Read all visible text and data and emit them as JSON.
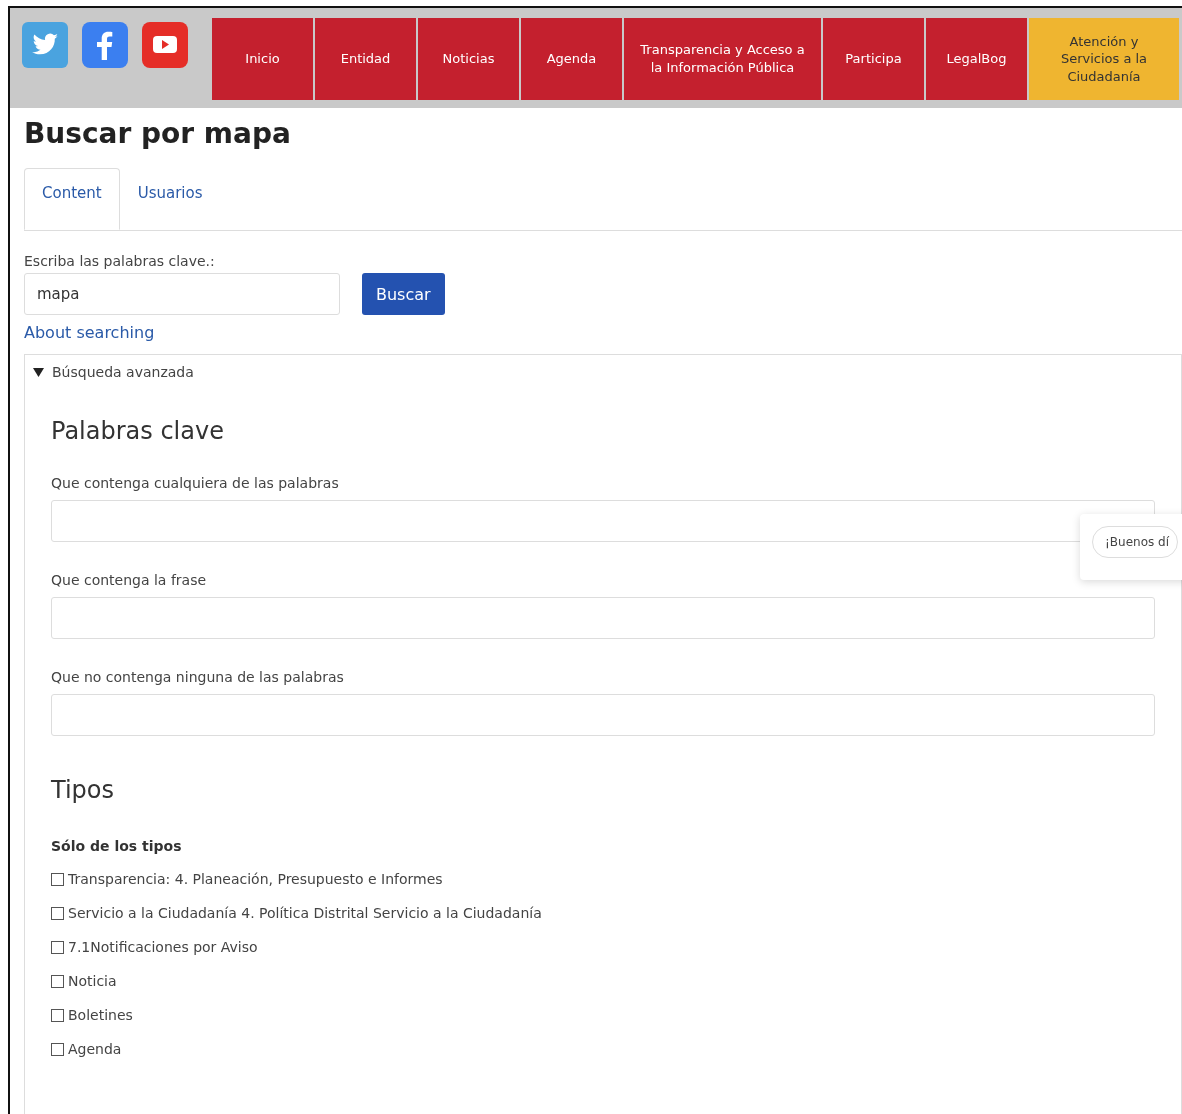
{
  "social": [
    {
      "kind": "twitter"
    },
    {
      "kind": "facebook"
    },
    {
      "kind": "youtube"
    }
  ],
  "nav": [
    {
      "label": "Inicio",
      "kind": "main"
    },
    {
      "label": "Entidad",
      "kind": "main"
    },
    {
      "label": "Noticias",
      "kind": "main"
    },
    {
      "label": "Agenda",
      "kind": "main"
    },
    {
      "label": "Transparencia y Acceso a la Información Pública",
      "kind": "main"
    },
    {
      "label": "Participa",
      "kind": "main"
    },
    {
      "label": "LegalBog",
      "kind": "main"
    },
    {
      "label": "Atención y Servicios a la Ciudadanía",
      "kind": "highlight"
    }
  ],
  "title": "Buscar por mapa",
  "tabs": [
    {
      "label": "Content",
      "selected": true
    },
    {
      "label": "Usuarios",
      "selected": false
    }
  ],
  "search": {
    "label": "Escriba las palabras clave.:",
    "value": "mapa",
    "button": "Buscar",
    "help_link": "About searching"
  },
  "advanced": {
    "summary": "Búsqueda avanzada",
    "expanded": true,
    "keywords_heading": "Palabras clave",
    "fields": [
      {
        "label": "Que contenga cualquiera de las palabras"
      },
      {
        "label": "Que contenga la frase"
      },
      {
        "label": "Que no contenga ninguna de las palabras"
      }
    ],
    "types_heading": "Tipos",
    "types_label": "Sólo de los tipos",
    "types": [
      {
        "label": "Transparencia: 4. Planeación, Presupuesto e Informes",
        "checked": false
      },
      {
        "label": "Servicio a la Ciudadanía 4. Política Distrital Servicio a la Ciudadanía",
        "checked": false
      },
      {
        "label": "7.1Notificaciones por Aviso",
        "checked": false
      },
      {
        "label": "Noticia",
        "checked": false
      },
      {
        "label": "Boletines",
        "checked": false
      },
      {
        "label": "Agenda",
        "checked": false
      }
    ]
  },
  "chat_bubble": "¡Buenos dí"
}
